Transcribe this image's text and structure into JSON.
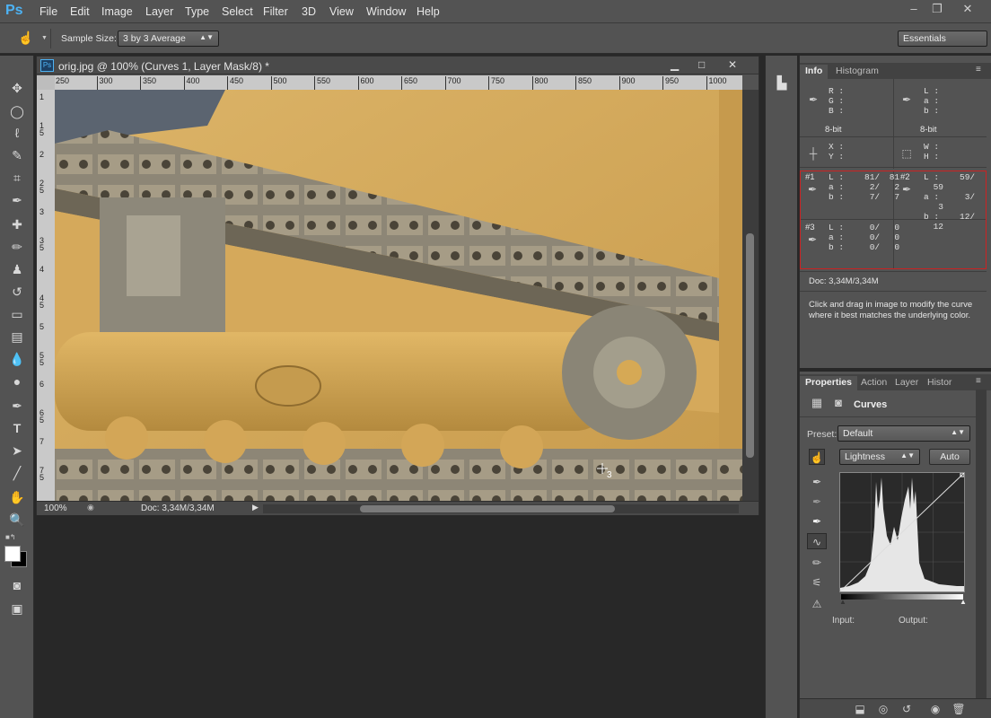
{
  "app": {
    "logo": "Ps",
    "menu": [
      "File",
      "Edit",
      "Image",
      "Layer",
      "Type",
      "Select",
      "Filter",
      "3D",
      "View",
      "Window",
      "Help"
    ],
    "window_controls": [
      "–",
      "❐",
      "✕"
    ]
  },
  "options_bar": {
    "sample_size_label": "Sample Size:",
    "sample_size_value": "3 by 3 Average",
    "workspace": "Essentials"
  },
  "document": {
    "title": "orig.jpg @ 100% (Curves 1, Layer Mask/8) *",
    "ruler_ticks": [
      "250",
      "300",
      "350",
      "400",
      "450",
      "500",
      "550",
      "600",
      "650",
      "700",
      "750",
      "800",
      "850",
      "900",
      "950",
      "1000"
    ],
    "ruler_left_ticks": [
      "1",
      "1\n5",
      "2",
      "2\n5",
      "3",
      "3\n5",
      "4",
      "4\n5",
      "5",
      "5\n5",
      "6",
      "6\n5",
      "7",
      "7\n5"
    ],
    "zoom": "100%",
    "doc_size": "Doc: 3,34M/3,34M",
    "sampler_label": "3"
  },
  "info_panel": {
    "tabs": [
      "Info",
      "Histogram"
    ],
    "rgb_labels": [
      "R :",
      "G :",
      "B :"
    ],
    "lab_labels": [
      "L :",
      "a :",
      "b :"
    ],
    "bit_left": "8-bit",
    "bit_right": "8-bit",
    "xy_labels": [
      "X :",
      "Y :"
    ],
    "wh_labels": [
      "W :",
      "H :"
    ],
    "samplers": [
      {
        "id": "#1",
        "rows": [
          [
            "L :",
            "81/",
            "81"
          ],
          [
            "a :",
            "2/",
            "2"
          ],
          [
            "b :",
            "7/",
            "7"
          ]
        ]
      },
      {
        "id": "#2",
        "rows": [
          [
            "L :",
            "59/",
            "59"
          ],
          [
            "a :",
            "3/",
            "3"
          ],
          [
            "b :",
            "12/",
            "12"
          ]
        ]
      },
      {
        "id": "#3",
        "rows": [
          [
            "L :",
            "0/",
            "0"
          ],
          [
            "a :",
            "0/",
            "0"
          ],
          [
            "b :",
            "0/",
            "0"
          ]
        ]
      }
    ],
    "doc_size": "Doc: 3,34M/3,34M",
    "hint": "Click and drag in image to modify the curve where it best matches the underlying color."
  },
  "properties_panel": {
    "tabs": [
      "Properties",
      "Action",
      "Layer",
      "Histor"
    ],
    "title": "Curves",
    "preset_label": "Preset:",
    "preset_value": "Default",
    "channel_value": "Lightness",
    "auto_label": "Auto",
    "input_label": "Input:",
    "output_label": "Output:"
  },
  "colors": {
    "accent": "#4db3f5",
    "panel_bg": "#535353",
    "red_box": "#cc2222",
    "canvas_yellow": "#d1a65a"
  }
}
